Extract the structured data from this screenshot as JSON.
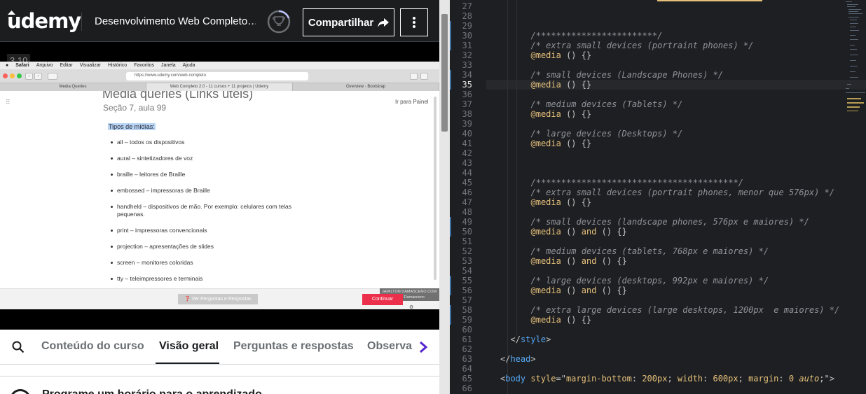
{
  "udemy": {
    "logo": "udemy",
    "course_title": "Desenvolvimento Web Completo…",
    "progress_icon": "trophy-icon",
    "share_label": "Compartilhar",
    "more_icon": "vertical-dots-icon",
    "video": {
      "timestamp": "3.10",
      "menubar": [
        "Safari",
        "Arquivo",
        "Editar",
        "Visualizar",
        "Histórico",
        "Favoritos",
        "Janela",
        "Ajuda"
      ],
      "url": "https://www.udemy.com/web-completo",
      "tabs": [
        "Media Queries",
        "Web Completo 2.0 - 11 cursos + 11 projetos | Udemy",
        "Overview · Bootstrap"
      ],
      "lecture_title": "Media queries (Links úteis)",
      "lecture_subtitle": "Seção 7, aula 99",
      "dashboard_link": "Ir para Painel",
      "media_heading": "Tipos de mídias:",
      "media_types": [
        "all – todos os dispositivos",
        "aural – sintetizadores de voz",
        "braille – leitores de Braille",
        "embossed – impressoras de Braille",
        "handheld – dispositivos de mão. Por exemplo: celulares com telas pequenas.",
        "print – impressoras convencionais",
        "projection – apresentações de slides",
        "screen – monitores coloridas",
        "tty – teleimpressores e terminais"
      ],
      "qa_button": "Ver Perguntas e Respostas",
      "continue_button": "Continuar",
      "watermark": "JAMILTON DAMASCENO.COM por Jamilton Damasceno"
    },
    "tabs": {
      "items": [
        "Conteúdo do curso",
        "Visão geral",
        "Perguntas e respostas",
        "Observa"
      ],
      "active": "Visão geral"
    },
    "reminder": "Programe um horário para o aprendizado"
  },
  "editor": {
    "current_line": 35,
    "lines": [
      {
        "n": 27,
        "html": ""
      },
      {
        "n": 28,
        "html": ""
      },
      {
        "n": 29,
        "html": ""
      },
      {
        "n": 30,
        "html": "<span class='c'>/************************/</span>",
        "indent": 3
      },
      {
        "n": 31,
        "html": "<span class='c'>/* extra small devices (portraint phones) */</span>",
        "indent": 3
      },
      {
        "n": 32,
        "html": "<span class='kw'>@media</span> () {}",
        "indent": 3
      },
      {
        "n": 33,
        "html": ""
      },
      {
        "n": 34,
        "html": "<span class='c'>/* small devices (Landscape Phones) */</span>",
        "indent": 3
      },
      {
        "n": 35,
        "html": "<span class='kw'>@media</span> () {}",
        "indent": 3
      },
      {
        "n": 36,
        "html": ""
      },
      {
        "n": 37,
        "html": "<span class='c'>/* medium devices (Tablets) */</span>",
        "indent": 3
      },
      {
        "n": 38,
        "html": "<span class='kw'>@media</span> () {}",
        "indent": 3
      },
      {
        "n": 39,
        "html": ""
      },
      {
        "n": 40,
        "html": "<span class='c'>/* large devices (Desktops) */</span>",
        "indent": 3
      },
      {
        "n": 41,
        "html": "<span class='kw'>@media</span> () {}",
        "indent": 3
      },
      {
        "n": 42,
        "html": ""
      },
      {
        "n": 43,
        "html": ""
      },
      {
        "n": 44,
        "html": ""
      },
      {
        "n": 45,
        "html": "<span class='c'>/****************************************/</span>",
        "indent": 3
      },
      {
        "n": 46,
        "html": "<span class='c'>/* extra small devices (portrait phones, menor que 576px) */</span>",
        "indent": 3
      },
      {
        "n": 47,
        "html": "<span class='kw'>@media</span> () {}",
        "indent": 3
      },
      {
        "n": 48,
        "html": ""
      },
      {
        "n": 49,
        "html": "<span class='c'>/* small devices (landscape phones, 576px e maiores) */</span>",
        "indent": 3
      },
      {
        "n": 50,
        "html": "<span class='kw'>@media</span> () <span class='kw'>and</span> () {}",
        "indent": 3
      },
      {
        "n": 51,
        "html": ""
      },
      {
        "n": 52,
        "html": "<span class='c'>/* medium devices (tablets, 768px e maiores) */</span>",
        "indent": 3
      },
      {
        "n": 53,
        "html": "<span class='kw'>@media</span> () <span class='kw'>and</span> () {}",
        "indent": 3
      },
      {
        "n": 54,
        "html": ""
      },
      {
        "n": 55,
        "html": "<span class='c'>/* large devices (desktops, 992px e maiores) */</span>",
        "indent": 3
      },
      {
        "n": 56,
        "html": "<span class='kw'>@media</span> () <span class='kw'>and</span> () {}",
        "indent": 3
      },
      {
        "n": 57,
        "html": ""
      },
      {
        "n": 58,
        "html": "<span class='c'>/* extra large devices (large desktops, 1200px  e maiores) */</span>",
        "indent": 3
      },
      {
        "n": 59,
        "html": "<span class='kw'>@media</span> () {}",
        "indent": 3
      },
      {
        "n": 60,
        "html": ""
      },
      {
        "n": 61,
        "html": "&lt;/<span class='tag'>style</span>&gt;",
        "indent": 1
      },
      {
        "n": 62,
        "html": ""
      },
      {
        "n": 63,
        "html": "&lt;/<span class='tag'>head</span>&gt;",
        "indent": 0
      },
      {
        "n": 64,
        "html": ""
      },
      {
        "n": 65,
        "html": "&lt;<span class='tag'>body</span> <span class='attr'>style</span>=\"<span class='str'>margin-bottom</span>: <span class='num'>200px</span>; <span class='str'>width</span>: <span class='num'>600px</span>; <span class='str'>margin</span>: <span class='num'>0</span> <span class='it'>auto</span>;\"&gt;",
        "indent": 0
      },
      {
        "n": 66,
        "html": ""
      }
    ],
    "modified_lines": [
      29,
      30,
      31,
      34,
      35,
      49,
      50,
      55,
      56,
      58,
      59
    ]
  },
  "colors": {
    "udemy_dark": "#1c1d1f",
    "editor_bg": "#1e1f22",
    "comment": "#8e9399",
    "keyword": "#e5c07b",
    "tag": "#56a8f5",
    "continue_red": "#ec2f4b"
  }
}
